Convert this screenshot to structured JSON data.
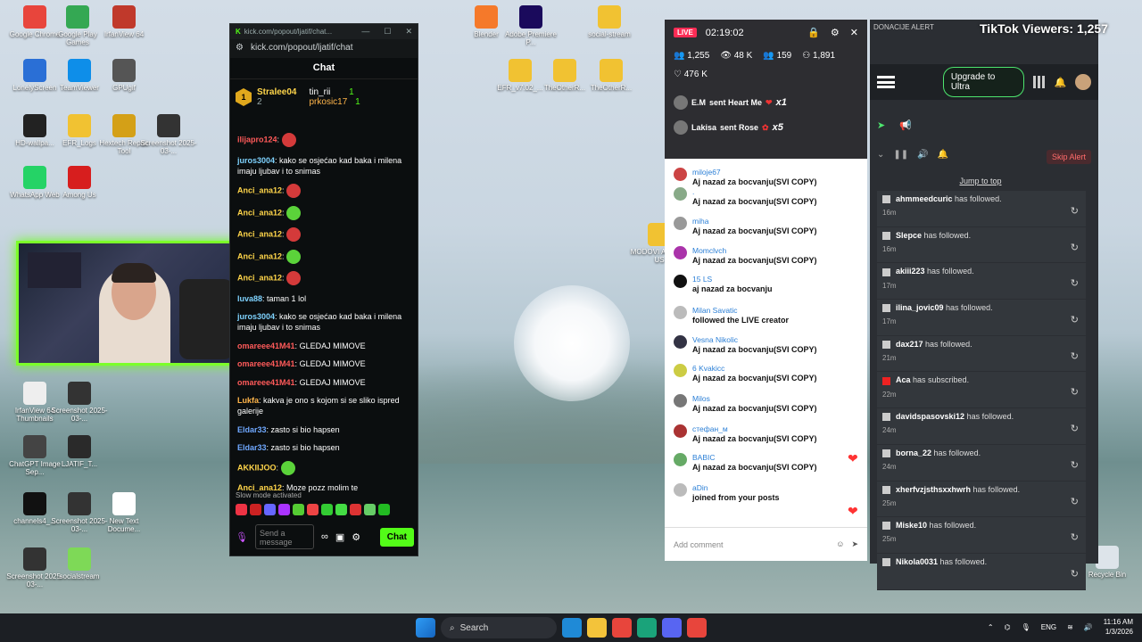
{
  "desktop": {
    "icons": [
      {
        "label": "Google Chrome",
        "color": "#e8453c"
      },
      {
        "label": "Google Play Games",
        "color": "#34a853"
      },
      {
        "label": "IrfanView 64",
        "color": "#c0392b"
      },
      {
        "label": "LonelyScreen",
        "color": "#2a6fd6"
      },
      {
        "label": "TeamViewer",
        "color": "#0e8ee9"
      },
      {
        "label": "GPUgif",
        "color": "#555555"
      },
      {
        "label": "HD-wallpa...",
        "color": "#222222"
      },
      {
        "label": "EFR_Logs",
        "color": "#f1c232"
      },
      {
        "label": "Hextech Repair Tool",
        "color": "#d4a017"
      },
      {
        "label": "Screenshot 2025-03-...",
        "color": "#333333"
      },
      {
        "label": "WhatsApp Web",
        "color": "#25d366"
      },
      {
        "label": "Among Us",
        "color": "#d71e1e"
      },
      {
        "label": "IrfanView 64 Thumbnails",
        "color": "#eeeeee"
      },
      {
        "label": "Screenshot 2025-03-...",
        "color": "#333333"
      },
      {
        "label": "ChatGPT Image Sep...",
        "color": "#444444"
      },
      {
        "label": "LJATIF_T...",
        "color": "#2a2a2a"
      },
      {
        "label": "channels4_...",
        "color": "#111111"
      },
      {
        "label": "Screenshot 2025-03-...",
        "color": "#333333"
      },
      {
        "label": "New Text Docume...",
        "color": "#ffffff"
      },
      {
        "label": "Screenshot 2025-03-...",
        "color": "#333333"
      },
      {
        "label": "socialstream",
        "color": "#7ed957"
      },
      {
        "label": "Blender",
        "color": "#f5792a"
      },
      {
        "label": "Adobe Premiere P...",
        "color": "#1a0a5c"
      },
      {
        "label": "social-stream",
        "color": "#f1c232"
      },
      {
        "label": "EFR_v7.02_...",
        "color": "#f1c232"
      },
      {
        "label": "TheOtherR...",
        "color": "#f1c232"
      },
      {
        "label": "TheOtherR...",
        "color": "#f1c232"
      },
      {
        "label": "MODOVI AMONG US",
        "color": "#f1c232"
      },
      {
        "label": "Recycle Bin",
        "color": "#dde4ea"
      }
    ]
  },
  "kick": {
    "title": "kick.com/popout/ljatif/chat...",
    "url": "kick.com/popout/ljatif/chat",
    "header": "Chat",
    "gifters": {
      "rank": "1",
      "first": "Stralee04",
      "first_count": "2",
      "second": "tin_rii",
      "second_count": "1",
      "third": "prkosic17",
      "third_count": "1"
    },
    "messages": [
      {
        "user": "ilijapro124",
        "color": "#ff5a5a",
        "text": ""
      },
      {
        "user": "juros3004",
        "color": "#7fd3ff",
        "text": "kako se osjećao kad baka i milena imaju ljubav i to snimas"
      },
      {
        "user": "Anci_ana12",
        "color": "#ffd54a",
        "text": ""
      },
      {
        "user": "Anci_ana12",
        "color": "#ffd54a",
        "text": ""
      },
      {
        "user": "Anci_ana12",
        "color": "#ffd54a",
        "text": ""
      },
      {
        "user": "Anci_ana12",
        "color": "#ffd54a",
        "text": ""
      },
      {
        "user": "Anci_ana12",
        "color": "#ffd54a",
        "text": ""
      },
      {
        "user": "luva88",
        "color": "#7fd3ff",
        "text": "taman 1 lol"
      },
      {
        "user": "juros3004",
        "color": "#7fd3ff",
        "text": "kako se osjećao kad baka i milena imaju ljubav i to snimas"
      },
      {
        "user": "omareee41M41",
        "color": "#ff5a5a",
        "text": "GLEDAJ MIMOVE"
      },
      {
        "user": "omareee41M41",
        "color": "#ff5a5a",
        "text": "GLEDAJ MIMOVE"
      },
      {
        "user": "omareee41M41",
        "color": "#ff5a5a",
        "text": "GLEDAJ MIMOVE"
      },
      {
        "user": "Lukfa",
        "color": "#ffb54a",
        "text": "kakva je ono s kojom si se sliko ispred galerije"
      },
      {
        "user": "Eldar33",
        "color": "#6fa8ff",
        "text": "zasto si bio hapsen"
      },
      {
        "user": "Eldar33",
        "color": "#6fa8ff",
        "text": "zasto si bio hapsen"
      },
      {
        "user": "AKKIIJOO",
        "color": "#ffd54a",
        "text": ""
      },
      {
        "user": "Anci_ana12",
        "color": "#ffd54a",
        "text": "Moze pozz molim te"
      }
    ],
    "slow_mode": "Slow mode activated",
    "input_placeholder": "Send a message",
    "send_label": "Chat"
  },
  "tiktok": {
    "live_badge": "LIVE",
    "timer": "02:19:02",
    "viewers": "1,255",
    "views": "48 K",
    "stat3": "159",
    "stat4": "1,891",
    "likes": "476 K",
    "gifts": [
      {
        "user": "E.M",
        "text": "sent Heart Me",
        "count": "x1"
      },
      {
        "user": "Lakisa",
        "text": "sent Rose",
        "count": "x5"
      }
    ],
    "feed": [
      {
        "name": "miloje67",
        "text": "Aj nazad za bocvanju(SVI COPY)",
        "color": "#c44"
      },
      {
        "name": ".",
        "text": "Aj nazad za bocvanju(SVI COPY)",
        "color": "#8a8"
      },
      {
        "name": "miha",
        "text": "Aj nazad za bocvanju(SVI COPY)",
        "color": "#999"
      },
      {
        "name": "Momclvch",
        "text": "Aj nazad za bocvanju(SVI COPY)",
        "color": "#a3a"
      },
      {
        "name": "15 LS",
        "text": "aj nazad za bocvanju",
        "color": "#111"
      },
      {
        "name": "Milan Savatic",
        "text": "followed the LIVE creator",
        "color": "#bbb"
      },
      {
        "name": "Vesna Nikolic",
        "text": "Aj nazad za bocvanju(SVI COPY)",
        "color": "#334"
      },
      {
        "name": "6 Kvakicc",
        "text": "Aj nazad za bocvanju(SVI COPY)",
        "color": "#cc4"
      },
      {
        "name": "Milos",
        "text": "Aj nazad za bocvanju(SVI COPY)",
        "color": "#777"
      },
      {
        "name": "стефан_м",
        "text": "Aj nazad za bocvanju(SVI COPY)",
        "color": "#a33"
      },
      {
        "name": "BABIC",
        "text": "Aj nazad za bocvanju(SVI COPY)",
        "color": "#6a6"
      },
      {
        "name": "aDin",
        "text": "joined from your posts",
        "color": "#bbb"
      }
    ],
    "add_comment": "Add comment"
  },
  "tiktok_viewers": "TikTok Viewers: 1,257",
  "donation": {
    "top_label": "DONACIJE ALERT",
    "upgrade": "Upgrade to Ultra",
    "skip": "Skip Alert",
    "jump": "Jump to top",
    "alerts": [
      {
        "user": "ahmmeedcuric",
        "action": "has followed.",
        "time": "16m"
      },
      {
        "user": "Slepce",
        "action": "has followed.",
        "time": "16m"
      },
      {
        "user": "akiii223",
        "action": "has followed.",
        "time": "17m"
      },
      {
        "user": "ilina_jovic09",
        "action": "has followed.",
        "time": "17m"
      },
      {
        "user": "dax217",
        "action": "has followed.",
        "time": "21m"
      },
      {
        "user": "Aca",
        "action": "has subscribed.",
        "time": "22m"
      },
      {
        "user": "davidspasovski12",
        "action": "has followed.",
        "time": "24m"
      },
      {
        "user": "borna_22",
        "action": "has followed.",
        "time": "24m"
      },
      {
        "user": "xherfvzjsthsxxhwrh",
        "action": "has followed.",
        "time": "25m"
      },
      {
        "user": "Miske10",
        "action": "has followed.",
        "time": "25m"
      },
      {
        "user": "Nikola0031",
        "action": "has followed.",
        "time": ""
      }
    ]
  },
  "taskbar": {
    "search": "Search",
    "lang": "ENG",
    "time": "11:16 AM",
    "date": "1/3/2026"
  }
}
